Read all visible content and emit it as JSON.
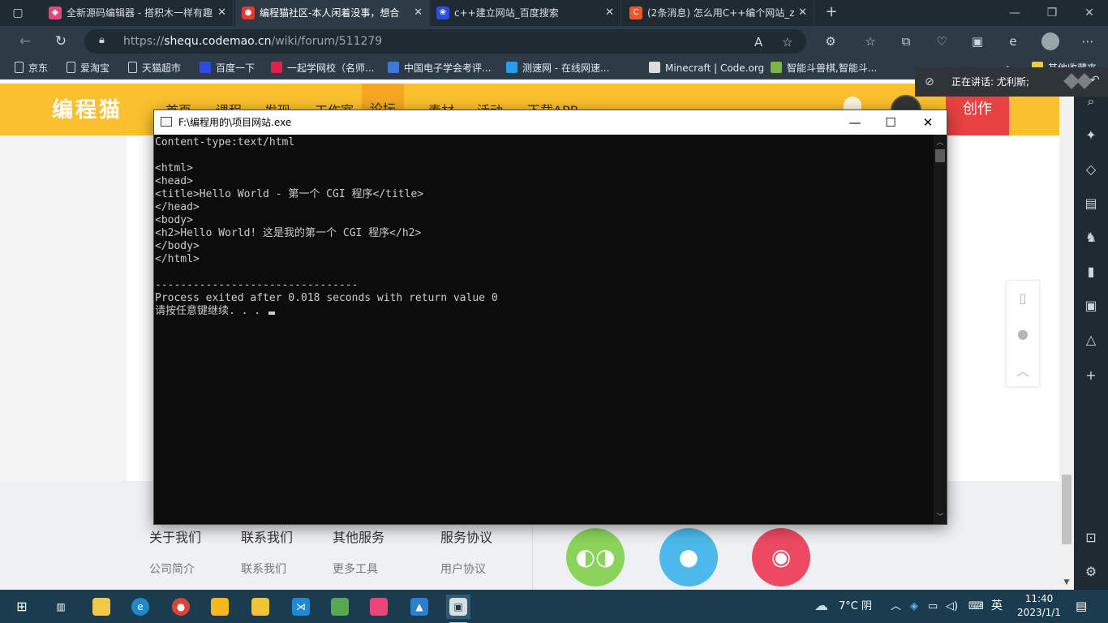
{
  "browser": {
    "tabs": [
      {
        "title": "全新源码编辑器 - 搭积木一样有趣",
        "favicon": "codemao-editor-icon",
        "color": "#e9467a",
        "active": false
      },
      {
        "title": "编程猫社区-本人闲着没事，想合",
        "favicon": "codemao-cat-icon",
        "color": "#e23b2e",
        "active": true
      },
      {
        "title": "c++建立网站_百度搜索",
        "favicon": "baidu-paw-icon",
        "color": "#2b4ee0",
        "active": false
      },
      {
        "title": "(2条消息) 怎么用C++编个网站_z",
        "favicon": "csdn-c-icon",
        "color": "#f0552b",
        "active": false
      }
    ],
    "url_prefix": "https://",
    "url_host": "shequ.codemao.cn",
    "url_path": "/wiki/forum/511279",
    "favorites": [
      {
        "label": "京东",
        "icon": "doc"
      },
      {
        "label": "爱淘宝",
        "icon": "doc"
      },
      {
        "label": "天猫超市",
        "icon": "doc"
      },
      {
        "label": "百度一下",
        "icon": "baidu",
        "color": "#2b4ee0"
      },
      {
        "label": "一起学网校（名师...",
        "icon": "arrow",
        "color": "#e2214a"
      },
      {
        "label": "中国电子学会考评...",
        "icon": "q",
        "color": "#3b7ad8"
      },
      {
        "label": "测速网 - 在线网速...",
        "icon": "bolt",
        "color": "#2a9bea"
      },
      {
        "label": "Minecraft | Code.org",
        "icon": "grid",
        "color": "#dddddd"
      },
      {
        "label": "智能斗兽棋,智能斗...",
        "icon": "grid",
        "color": "#7cb342"
      }
    ],
    "favorites_overflow": "其他收藏夹"
  },
  "speaking": {
    "text": "正在讲话: 尤利斯;"
  },
  "site": {
    "logo": "编程猫",
    "nav": [
      "首页",
      "课程",
      "发现",
      "工作室",
      "论坛",
      "素材",
      "活动",
      "下载APP"
    ],
    "active_nav": "论坛",
    "create_label": "创作",
    "footer": {
      "columns": [
        {
          "head": "关于我们",
          "link": "公司简介"
        },
        {
          "head": "联系我们",
          "link": "联系我们"
        },
        {
          "head": "其他服务",
          "link": "更多工具"
        },
        {
          "head": "服务协议",
          "link": "用户协议"
        }
      ],
      "social": [
        {
          "name": "wechat",
          "color": "#8bd45b"
        },
        {
          "name": "qq",
          "color": "#4bb9ea"
        },
        {
          "name": "weibo",
          "color": "#ec4a62"
        }
      ]
    }
  },
  "console": {
    "title": "F:\\编程用的\\项目网站.exe",
    "lines": [
      "Content-type:text/html",
      "",
      "<html>",
      "<head>",
      "<title>Hello World - 第一个 CGI 程序</title>",
      "</head>",
      "<body>",
      "<h2>Hello World! 这是我的第一个 CGI 程序</h2>",
      "</body>",
      "</html>",
      "",
      "--------------------------------",
      "Process exited after 0.018 seconds with return value 0",
      "请按任意键继续. . . "
    ]
  },
  "taskbar": {
    "weather": "7°C 阴",
    "ime": "英",
    "time": "11:40",
    "date": "2023/1/1"
  }
}
